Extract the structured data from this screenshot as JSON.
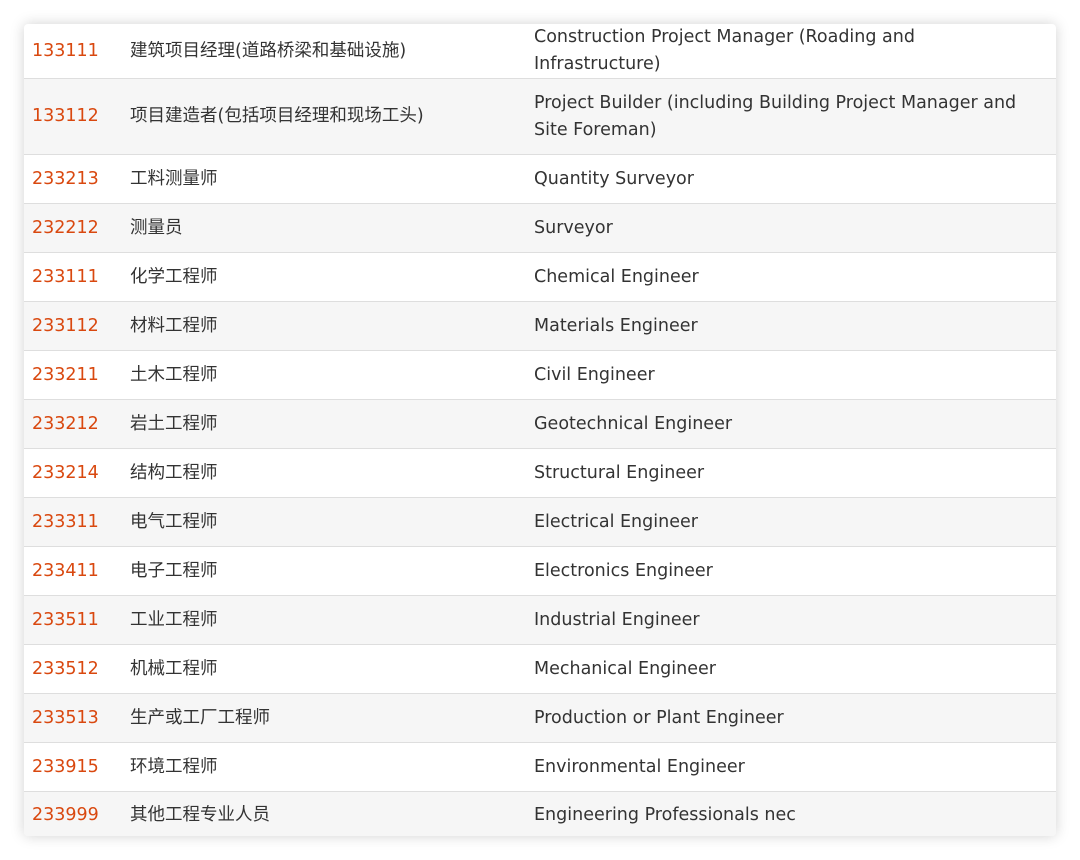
{
  "table": {
    "rows": [
      {
        "code": "133111",
        "cn": "建筑项目经理(道路桥梁和基础设施)",
        "en": "Construction Project Manager (Roading and Infrastructure)"
      },
      {
        "code": "133112",
        "cn": "项目建造者(包括项目经理和现场工头)",
        "en": "Project Builder (including Building Project Manager and Site Foreman)"
      },
      {
        "code": "233213",
        "cn": "工料测量师",
        "en": "Quantity Surveyor"
      },
      {
        "code": "232212",
        "cn": "测量员",
        "en": "Surveyor"
      },
      {
        "code": "233111",
        "cn": "化学工程师",
        "en": "Chemical Engineer"
      },
      {
        "code": "233112",
        "cn": "材料工程师",
        "en": "Materials Engineer"
      },
      {
        "code": "233211",
        "cn": "土木工程师",
        "en": "Civil Engineer"
      },
      {
        "code": "233212",
        "cn": "岩土工程师",
        "en": "Geotechnical Engineer"
      },
      {
        "code": "233214",
        "cn": "结构工程师",
        "en": "Structural Engineer"
      },
      {
        "code": "233311",
        "cn": "电气工程师",
        "en": "Electrical Engineer"
      },
      {
        "code": "233411",
        "cn": "电子工程师",
        "en": "Electronics Engineer"
      },
      {
        "code": "233511",
        "cn": "工业工程师",
        "en": "Industrial Engineer"
      },
      {
        "code": "233512",
        "cn": "机械工程师",
        "en": "Mechanical Engineer"
      },
      {
        "code": "233513",
        "cn": "生产或工厂工程师",
        "en": "Production or Plant Engineer"
      },
      {
        "code": "233915",
        "cn": "环境工程师",
        "en": "Environmental Engineer"
      },
      {
        "code": "233999",
        "cn": "其他工程专业人员",
        "en": "Engineering Professionals nec"
      }
    ]
  },
  "colors": {
    "code_text": "#d9480f",
    "body_text": "#333333",
    "stripe": "#f6f6f6",
    "divider": "#dedede"
  }
}
